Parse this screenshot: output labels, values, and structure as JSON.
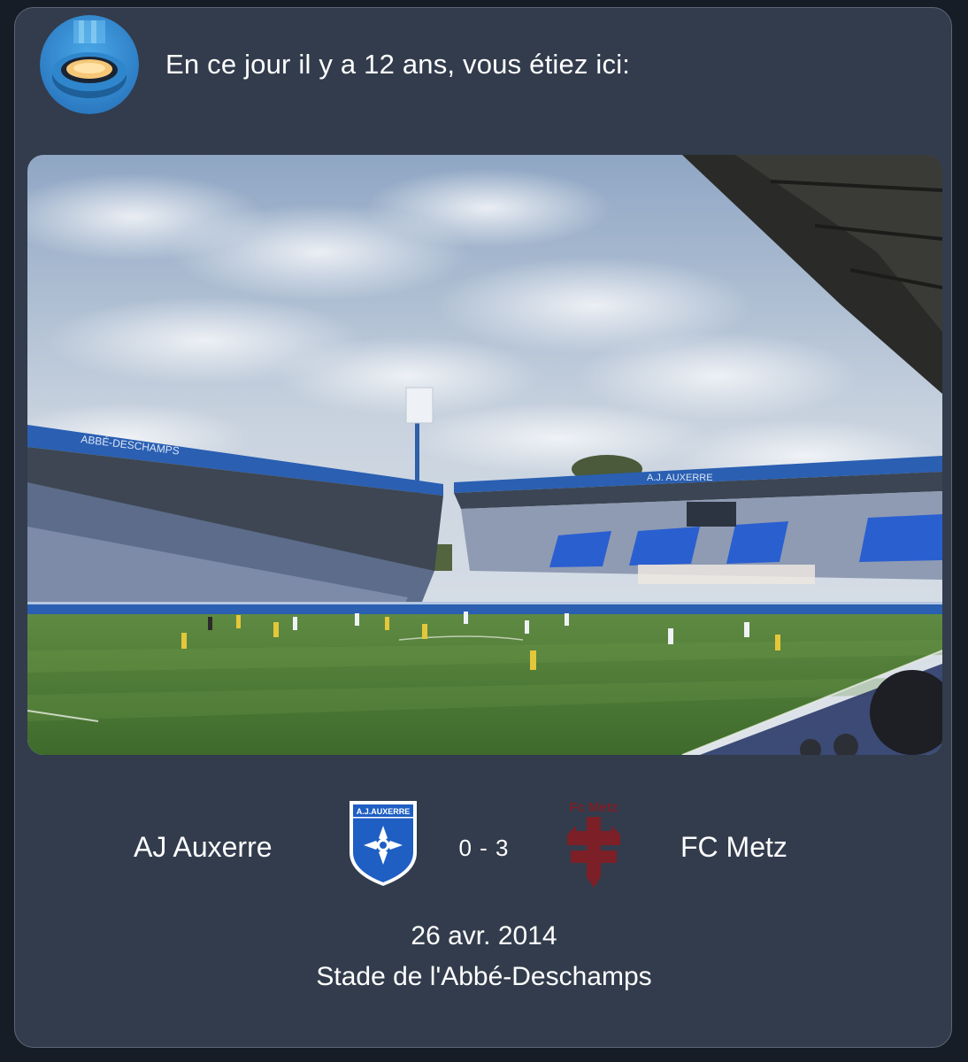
{
  "header": {
    "icon": "stadium-icon",
    "text": "En ce jour il y a 12 ans, vous étiez ici:"
  },
  "photo": {
    "subject": "stadium-photo",
    "stand_banner_left": "ABBÉ-DESCHAMPS",
    "stand_banner_right": "A.J. AUXERRE"
  },
  "match": {
    "home_team": "AJ Auxerre",
    "home_crest_text": "A.J.AUXERRE",
    "away_team": "FC Metz",
    "away_crest_text": "Fc Metz",
    "score": "0 - 3",
    "date": "26 avr. 2014",
    "venue": "Stade de l'Abbé-Deschamps"
  },
  "colors": {
    "card_background": "#323c4c",
    "card_border": "#5b6677",
    "auxerre_blue": "#1f5fc4",
    "metz_maroon": "#7d1f26"
  }
}
